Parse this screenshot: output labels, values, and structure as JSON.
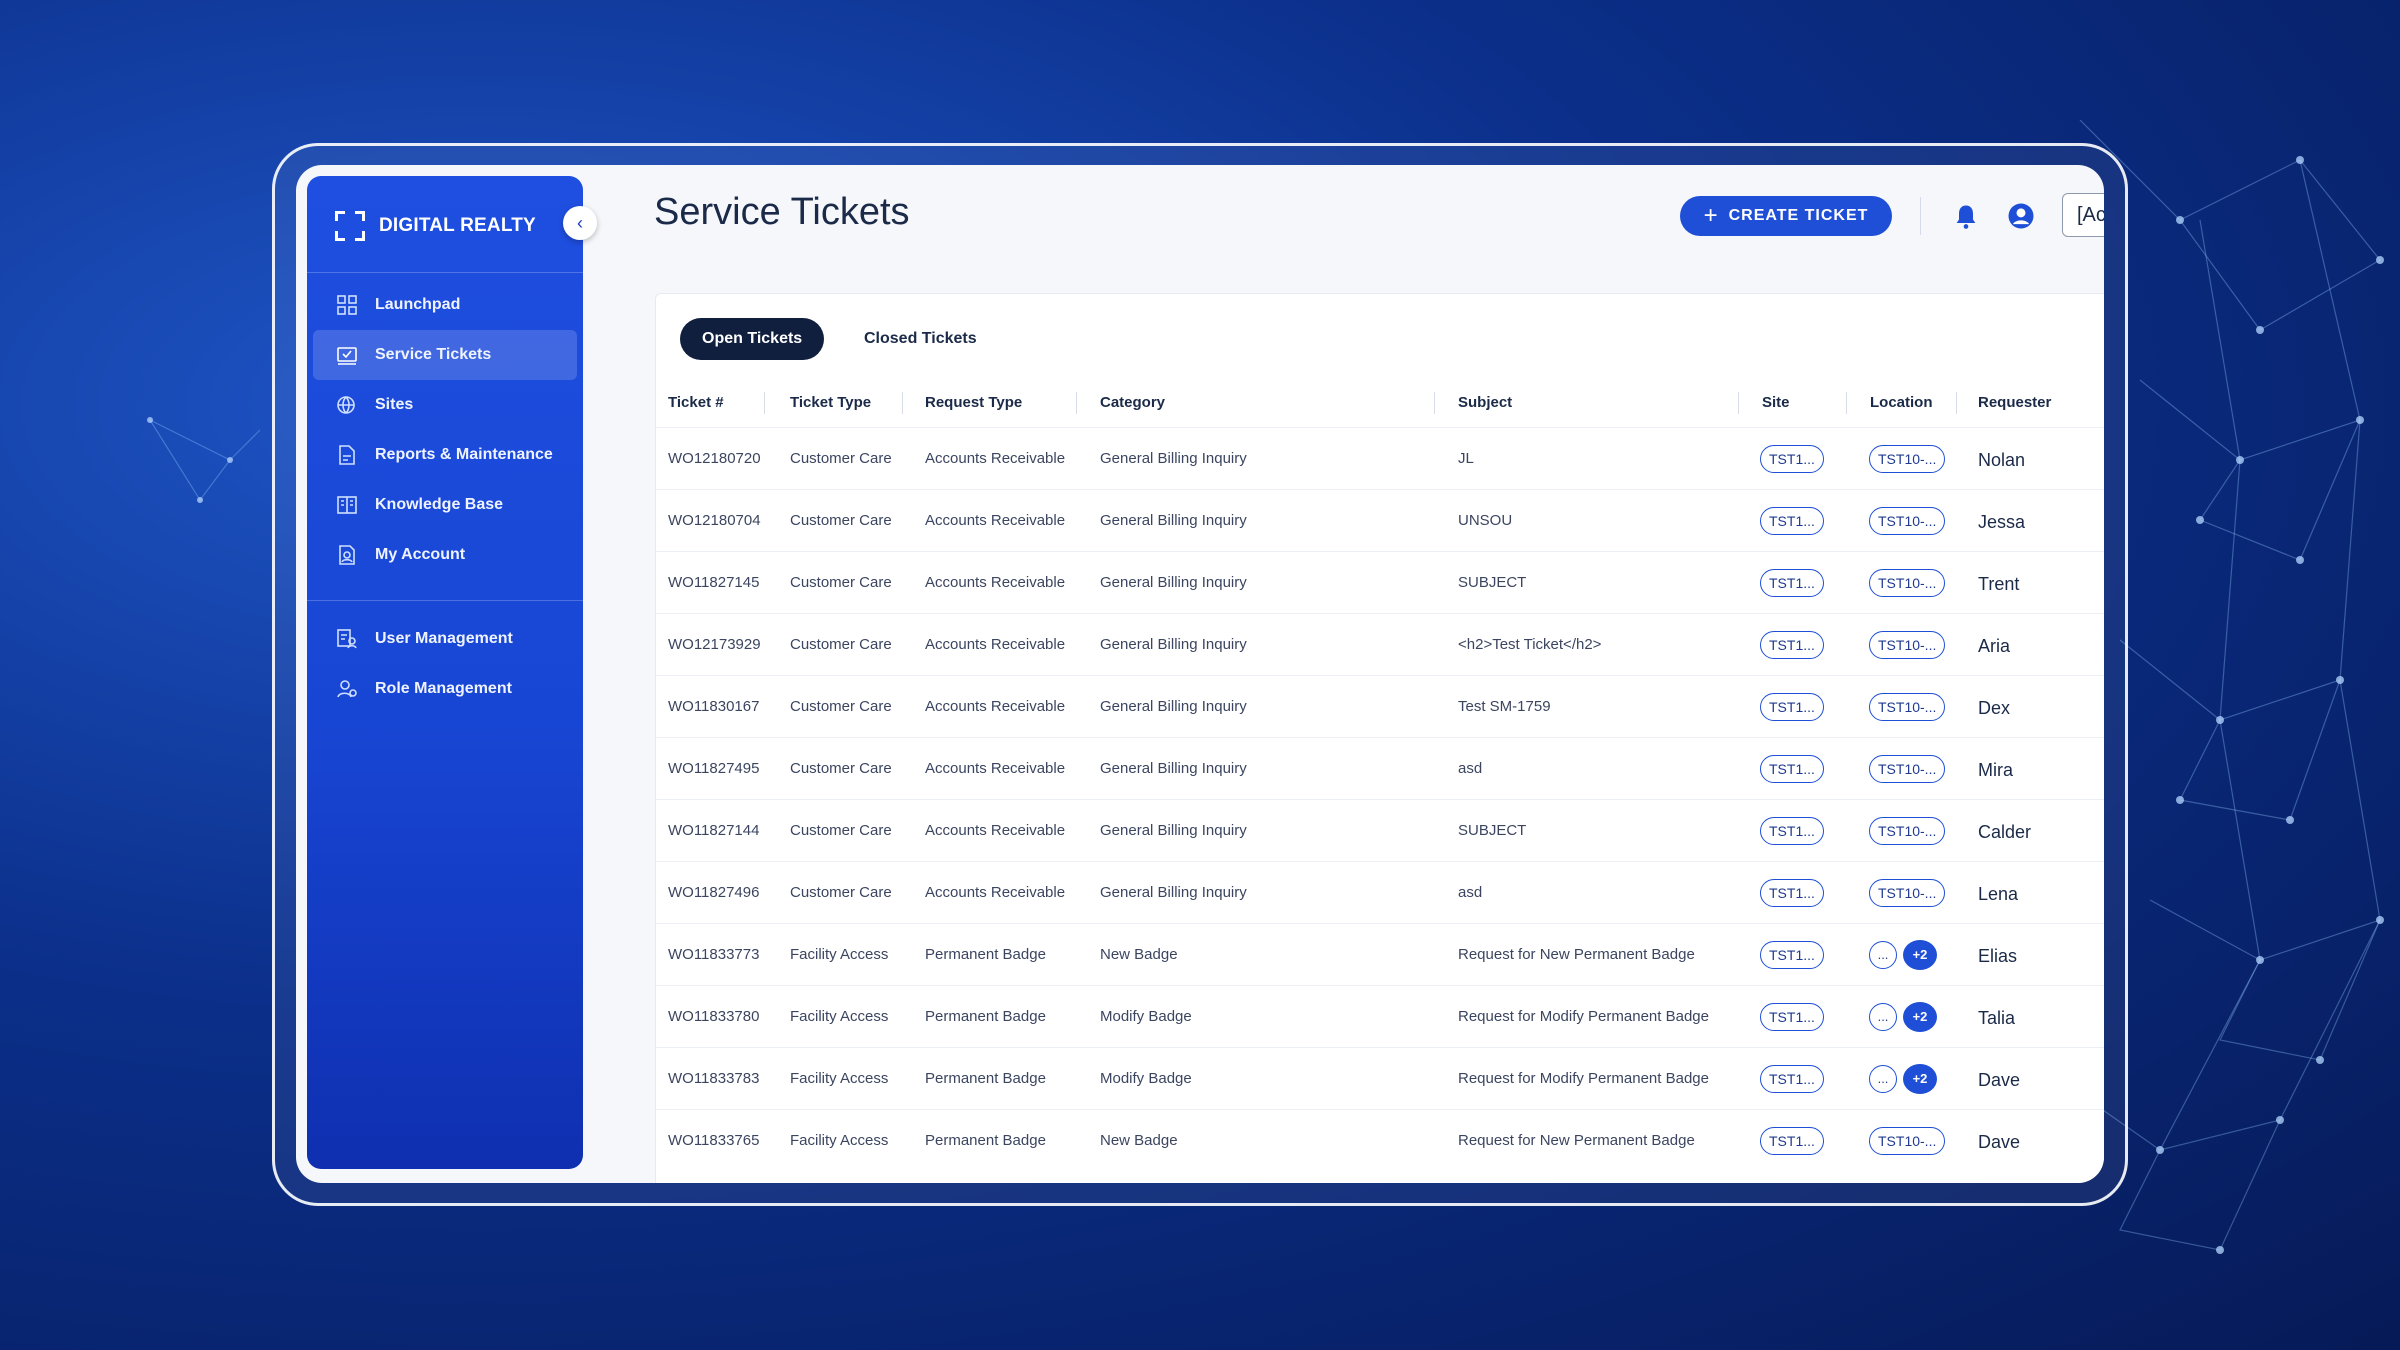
{
  "brand": {
    "name": "DIGITAL REALTY"
  },
  "sidebar": {
    "items": [
      {
        "label": "Launchpad",
        "icon": "grid-icon",
        "active": false
      },
      {
        "label": "Service Tickets",
        "icon": "ticket-icon",
        "active": true
      },
      {
        "label": "Sites",
        "icon": "globe-icon",
        "active": false
      },
      {
        "label": "Reports & Maintenance",
        "icon": "report-icon",
        "active": false
      },
      {
        "label": "Knowledge Base",
        "icon": "book-icon",
        "active": false
      },
      {
        "label": "My Account",
        "icon": "account-icon",
        "active": false
      }
    ],
    "admin_items": [
      {
        "label": "User Management",
        "icon": "users-icon"
      },
      {
        "label": "Role Management",
        "icon": "role-icon"
      }
    ]
  },
  "header": {
    "title": "Service Tickets",
    "create_label": "CREATE TICKET",
    "account_value": "[Ac"
  },
  "tabs": [
    {
      "label": "Open Tickets",
      "active": true
    },
    {
      "label": "Closed Tickets",
      "active": false
    }
  ],
  "table": {
    "columns": [
      "Ticket #",
      "Ticket Type",
      "Request Type",
      "Category",
      "Subject",
      "Site",
      "Location",
      "Requester"
    ],
    "rows": [
      {
        "ticket": "WO12180720",
        "type": "Customer Care",
        "request": "Accounts Receivable",
        "category": "General Billing Inquiry",
        "subject": "JL",
        "site": "TST1...",
        "location": "TST10-...",
        "requester": "Nolan"
      },
      {
        "ticket": "WO12180704",
        "type": "Customer Care",
        "request": "Accounts Receivable",
        "category": "General Billing Inquiry",
        "subject": "UNSOU",
        "site": "TST1...",
        "location": "TST10-...",
        "requester": "Jessa"
      },
      {
        "ticket": "WO11827145",
        "type": "Customer Care",
        "request": "Accounts Receivable",
        "category": "General Billing Inquiry",
        "subject": "SUBJECT",
        "site": "TST1...",
        "location": "TST10-...",
        "requester": "Trent"
      },
      {
        "ticket": "WO12173929",
        "type": "Customer Care",
        "request": "Accounts Receivable",
        "category": "General Billing Inquiry",
        "subject": "<h2>Test Ticket</h2>",
        "site": "TST1...",
        "location": "TST10-...",
        "requester": "Aria"
      },
      {
        "ticket": "WO11830167",
        "type": "Customer Care",
        "request": "Accounts Receivable",
        "category": "General Billing Inquiry",
        "subject": "Test SM-1759",
        "site": "TST1...",
        "location": "TST10-...",
        "requester": "Dex"
      },
      {
        "ticket": "WO11827495",
        "type": "Customer Care",
        "request": "Accounts Receivable",
        "category": "General Billing Inquiry",
        "subject": "asd",
        "site": "TST1...",
        "location": "TST10-...",
        "requester": "Mira"
      },
      {
        "ticket": "WO11827144",
        "type": "Customer Care",
        "request": "Accounts Receivable",
        "category": "General Billing Inquiry",
        "subject": "SUBJECT",
        "site": "TST1...",
        "location": "TST10-...",
        "requester": "Calder"
      },
      {
        "ticket": "WO11827496",
        "type": "Customer Care",
        "request": "Accounts Receivable",
        "category": "General Billing Inquiry",
        "subject": "asd",
        "site": "TST1...",
        "location": "TST10-...",
        "requester": "Lena"
      },
      {
        "ticket": "WO11833773",
        "type": "Facility Access",
        "request": "Permanent Badge",
        "category": "New Badge",
        "subject": "Request for New Permanent Badge",
        "site": "TST1...",
        "location": "...",
        "location_more": "+2",
        "requester": "Elias"
      },
      {
        "ticket": "WO11833780",
        "type": "Facility Access",
        "request": "Permanent Badge",
        "category": "Modify Badge",
        "subject": "Request for Modify Permanent Badge",
        "site": "TST1...",
        "location": "...",
        "location_more": "+2",
        "requester": "Talia"
      },
      {
        "ticket": "WO11833783",
        "type": "Facility Access",
        "request": "Permanent Badge",
        "category": "Modify Badge",
        "subject": "Request for Modify Permanent Badge",
        "site": "TST1...",
        "location": "...",
        "location_more": "+2",
        "requester": "Dave"
      },
      {
        "ticket": "WO11833765",
        "type": "Facility Access",
        "request": "Permanent Badge",
        "category": "New Badge",
        "subject": "Request for New Permanent Badge",
        "site": "TST1...",
        "location": "TST10-...",
        "requester": "Dave"
      }
    ]
  },
  "colors": {
    "accent": "#1f4fd6",
    "sidebar": "#1846d4",
    "dark_tab": "#0f1f3d"
  }
}
